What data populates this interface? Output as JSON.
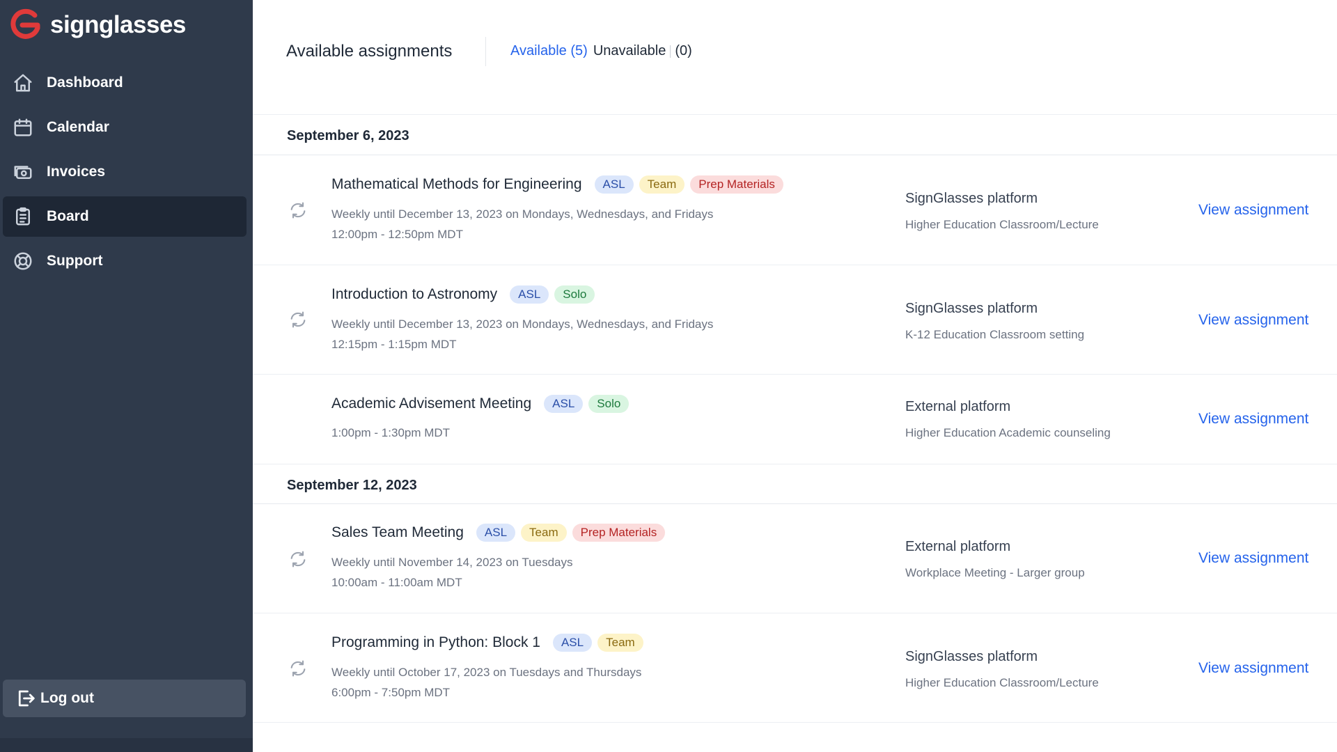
{
  "brand": {
    "name": "signglasses",
    "color": "#e03a3a"
  },
  "nav": {
    "items": [
      {
        "label": "Dashboard",
        "icon": "home-icon"
      },
      {
        "label": "Calendar",
        "icon": "calendar-icon"
      },
      {
        "label": "Invoices",
        "icon": "invoices-icon"
      },
      {
        "label": "Board",
        "icon": "clipboard-icon",
        "active": true
      },
      {
        "label": "Support",
        "icon": "lifebuoy-icon"
      }
    ],
    "logout_label": "Log out"
  },
  "header": {
    "title": "Available assignments",
    "tab_available": "Available (5)",
    "tab_unavailable": "Unavailable",
    "tab_unavailable_count": "(0)"
  },
  "groups": [
    {
      "date": "September 6, 2023",
      "assignments": [
        {
          "title": "Mathematical Methods for Engineering",
          "recurring": true,
          "badges": [
            "ASL",
            "Team",
            "Prep Materials"
          ],
          "schedule": "Weekly until December 13, 2023 on Mondays, Wednesdays, and Fridays",
          "time": "12:00pm - 12:50pm MDT",
          "platform": "SignGlasses platform",
          "setting": "Higher Education Classroom/Lecture",
          "link": "View assignment"
        },
        {
          "title": "Introduction to Astronomy",
          "recurring": true,
          "badges": [
            "ASL",
            "Solo"
          ],
          "schedule": "Weekly until December 13, 2023 on Mondays, Wednesdays, and Fridays",
          "time": "12:15pm - 1:15pm MDT",
          "platform": "SignGlasses platform",
          "setting": "K-12 Education Classroom setting",
          "link": "View assignment"
        },
        {
          "title": "Academic Advisement Meeting",
          "recurring": false,
          "badges": [
            "ASL",
            "Solo"
          ],
          "schedule": "",
          "time": "1:00pm - 1:30pm MDT",
          "platform": "External platform",
          "setting": "Higher Education Academic counseling",
          "link": "View assignment"
        }
      ]
    },
    {
      "date": "September 12, 2023",
      "assignments": [
        {
          "title": "Sales Team Meeting",
          "recurring": true,
          "badges": [
            "ASL",
            "Team",
            "Prep Materials"
          ],
          "schedule": "Weekly until November 14, 2023 on Tuesdays",
          "time": "10:00am - 11:00am MDT",
          "platform": "External platform",
          "setting": "Workplace Meeting - Larger group",
          "link": "View assignment"
        },
        {
          "title": "Programming in Python: Block 1",
          "recurring": true,
          "badges": [
            "ASL",
            "Team"
          ],
          "schedule": "Weekly until October 17, 2023 on Tuesdays and Thursdays",
          "time": "6:00pm - 7:50pm MDT",
          "platform": "SignGlasses platform",
          "setting": "Higher Education Classroom/Lecture",
          "link": "View assignment"
        }
      ]
    }
  ]
}
